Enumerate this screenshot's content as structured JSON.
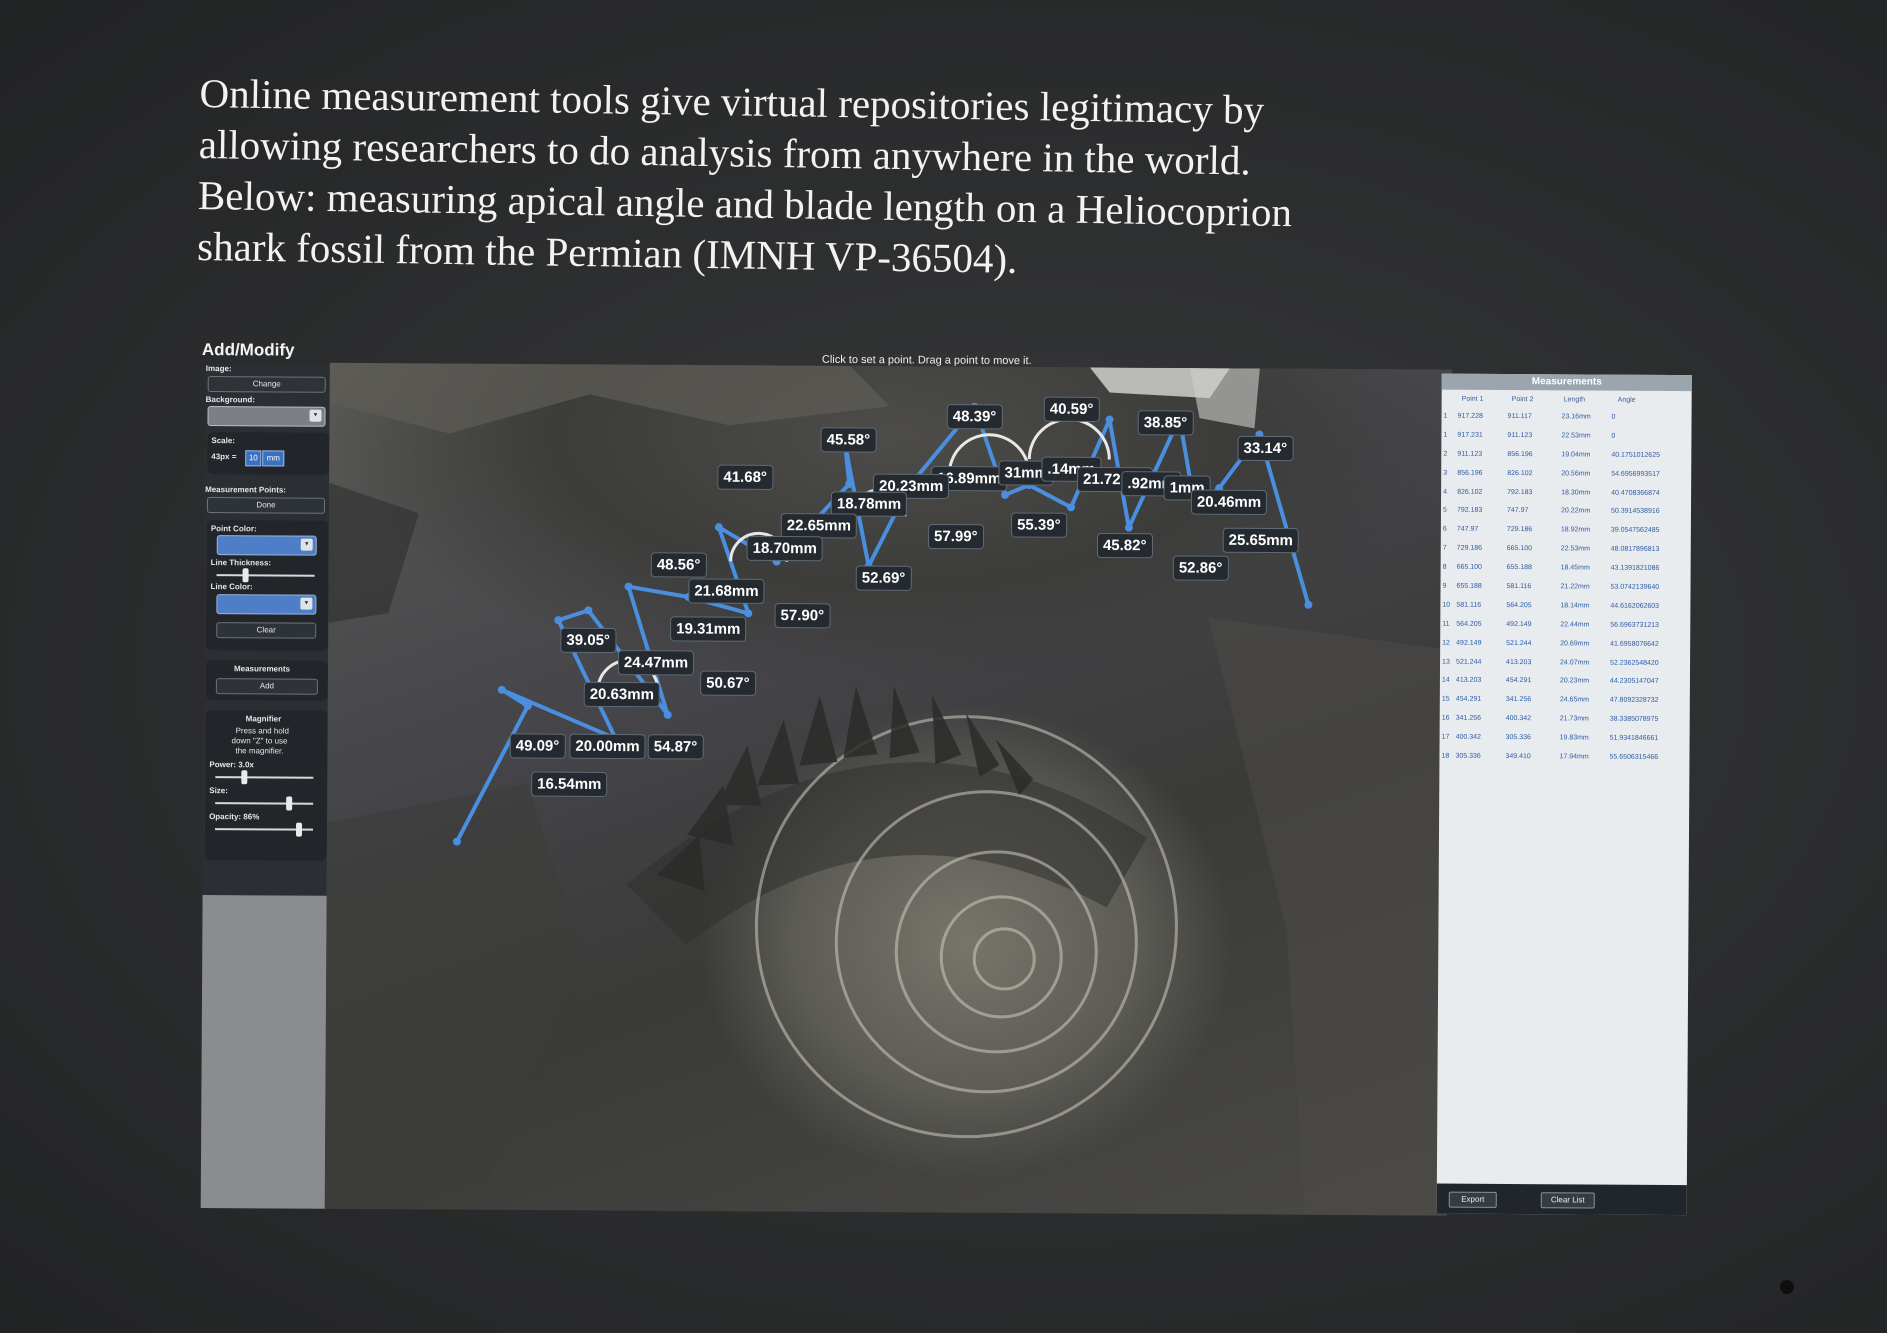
{
  "caption": {
    "lines": [
      "Online measurement tools give virtual repositories legitimacy by",
      "allowing researchers to do analysis from anywhere in the world.",
      "Below: measuring apical angle and blade length on a Heliocoprion",
      "shark fossil from the Permian (IMNH VP-36504)."
    ]
  },
  "left_panel": {
    "title": "Add/Modify",
    "image_label": "Image:",
    "change_button": "Change",
    "background_label": "Background:",
    "scale_label": "Scale:",
    "scale_px": "43px =",
    "scale_value": "10",
    "scale_unit": "mm",
    "measurement_points_label": "Measurement Points:",
    "done_button": "Done",
    "point_color_label": "Point Color:",
    "line_thickness_label": "Line Thickness:",
    "line_color_label": "Line Color:",
    "clear_button": "Clear",
    "measurements_label": "Measurements",
    "add_button": "Add",
    "magnifier_label": "Magnifier",
    "magnifier_hint_1": "Press and hold",
    "magnifier_hint_2": "down \"Z\" to use",
    "magnifier_hint_3": "the magnifier.",
    "power_label": "Power: 3.0x",
    "size_label": "Size:",
    "opacity_label": "Opacity: 86%",
    "line_thickness_level": 0.3,
    "power_level": 0.3,
    "size_level": 0.75,
    "opacity_level": 0.86,
    "point_color": "#4f7ec9",
    "line_color": "#4f7ec9",
    "background_color": "#7b8086"
  },
  "instruction": "Click to set a point. Drag a point to move it.",
  "measurement_color": "#4a8ee0",
  "labels": [
    {
      "text": "48.39°"
    },
    {
      "text": "40.59°"
    },
    {
      "text": "38.85°"
    },
    {
      "text": "45.58°"
    },
    {
      "text": "33.14°"
    },
    {
      "text": "16.89mm"
    },
    {
      "text": "31mm"
    },
    {
      "text": ".14mm"
    },
    {
      "text": "21.72mm"
    },
    {
      "text": ".92mm"
    },
    {
      "text": "1mm"
    },
    {
      "text": "41.68°"
    },
    {
      "text": "20.23mm"
    },
    {
      "text": "20.46mm"
    },
    {
      "text": "18.78mm"
    },
    {
      "text": "22.65mm"
    },
    {
      "text": "55.39°"
    },
    {
      "text": "57.99°"
    },
    {
      "text": "45.82°"
    },
    {
      "text": "25.65mm"
    },
    {
      "text": "18.70mm"
    },
    {
      "text": "52.86°"
    },
    {
      "text": "48.56°"
    },
    {
      "text": "52.69°"
    },
    {
      "text": "21.68mm"
    },
    {
      "text": "57.90°"
    },
    {
      "text": "19.31mm"
    },
    {
      "text": "39.05°"
    },
    {
      "text": "24.47mm"
    },
    {
      "text": "50.67°"
    },
    {
      "text": "20.63mm"
    },
    {
      "text": "49.09°"
    },
    {
      "text": "20.00mm"
    },
    {
      "text": "54.87°"
    },
    {
      "text": "16.54mm"
    }
  ],
  "table": {
    "title": "Measurements",
    "columns": [
      "Point 1",
      "Point 2",
      "Length",
      "Angle"
    ],
    "rows": [
      [
        "1",
        "917.228",
        "911.117",
        "23.16mm",
        "0"
      ],
      [
        "1",
        "917.231",
        "911.123",
        "22.53mm",
        "0"
      ],
      [
        "2",
        "911.123",
        "856.196",
        "19.04mm",
        "40.1751012625"
      ],
      [
        "3",
        "856.196",
        "826.102",
        "20.56mm",
        "54.6956993517"
      ],
      [
        "4",
        "826.102",
        "792.183",
        "18.30mm",
        "40.4708366874"
      ],
      [
        "5",
        "792.183",
        "747.97",
        "20.22mm",
        "50.3914538916"
      ],
      [
        "6",
        "747.97",
        "729.186",
        "18.92mm",
        "39.0547562485"
      ],
      [
        "7",
        "729.186",
        "665.100",
        "22.53mm",
        "48.0817896813"
      ],
      [
        "8",
        "665.100",
        "655.188",
        "18.45mm",
        "43.1391821086"
      ],
      [
        "9",
        "655.188",
        "581.116",
        "21.22mm",
        "53.0742139640"
      ],
      [
        "10",
        "581.116",
        "564.205",
        "18.14mm",
        "44.6162062603"
      ],
      [
        "11",
        "564.205",
        "492.149",
        "22.44mm",
        "56.6963731213"
      ],
      [
        "12",
        "492.149",
        "521.244",
        "20.69mm",
        "41.6958076642"
      ],
      [
        "13",
        "521.244",
        "413.203",
        "24.07mm",
        "52.2362548420"
      ],
      [
        "14",
        "413.203",
        "454.291",
        "20.23mm",
        "44.2305147047"
      ],
      [
        "15",
        "454.291",
        "341.256",
        "24.65mm",
        "47.8092328732"
      ],
      [
        "16",
        "341.256",
        "400.342",
        "21.73mm",
        "38.3385078975"
      ],
      [
        "17",
        "400.342",
        "305.336",
        "19.83mm",
        "51.9341846661"
      ],
      [
        "18",
        "305.336",
        "349.410",
        "17.94mm",
        "55.6506315466"
      ]
    ],
    "export_button": "Export",
    "clear_list_button": "Clear List"
  }
}
